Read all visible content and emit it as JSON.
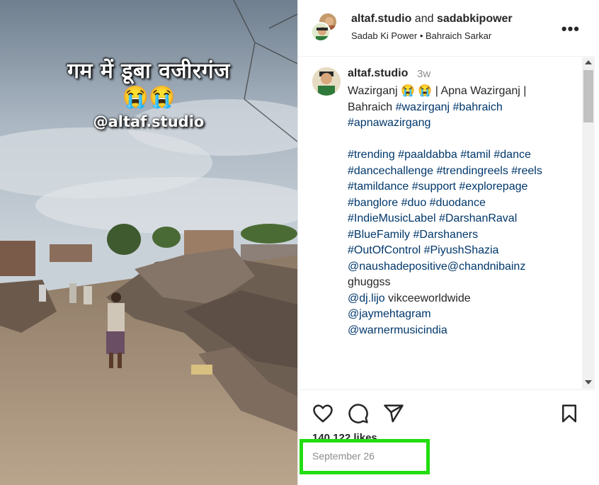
{
  "media": {
    "overlay_title": "गम में डूबा वजीरगंज",
    "overlay_emoji": "😭😭",
    "overlay_handle": "@altaf.studio"
  },
  "header": {
    "user1": "altaf.studio",
    "and": "and",
    "user2": "sadabkipower",
    "subtitle": "Sadab Ki Power • Bahraich Sarkar",
    "more_label": "•••"
  },
  "caption": {
    "username": "altaf.studio",
    "time_ago": "3w",
    "line1_a": "Wazirganj 😭 😭 | Apna Wazirganj |",
    "line2_a": "Bahraich ",
    "line2_t1": "#wazirganj",
    "line2_t2": "#bahraich",
    "line3_t": "#apnawazirgang",
    "tags1": "#trending #paaldabba #tamil #dance",
    "tags2": "#dancechallenge #trendingreels #reels",
    "tags3": "#tamildance #support #explorepage",
    "tags4": "#banglore #duo #duodance",
    "tags5": "#IndieMusicLabel #DarshanRaval",
    "tags6": "#BlueFamily #Darshaners",
    "tags7": "#OutOfControl #PiyushShazia",
    "mention1": "@naushadepositive",
    "mention2": "@chandnibainz",
    "text_ghuggss": "ghuggss",
    "mention3": "@dj.lijo",
    "text_vikcee": " vikceeworldwide",
    "mention4": "@jaymehtagram",
    "mention5": "@warnermusicindia"
  },
  "engagement": {
    "likes": "140,122 likes",
    "date": "September 26"
  },
  "icons": {
    "like": "heart-icon",
    "comment": "comment-icon",
    "share": "share-icon",
    "save": "bookmark-icon"
  },
  "colors": {
    "link": "#00376b",
    "highlight": "#22dd11"
  }
}
